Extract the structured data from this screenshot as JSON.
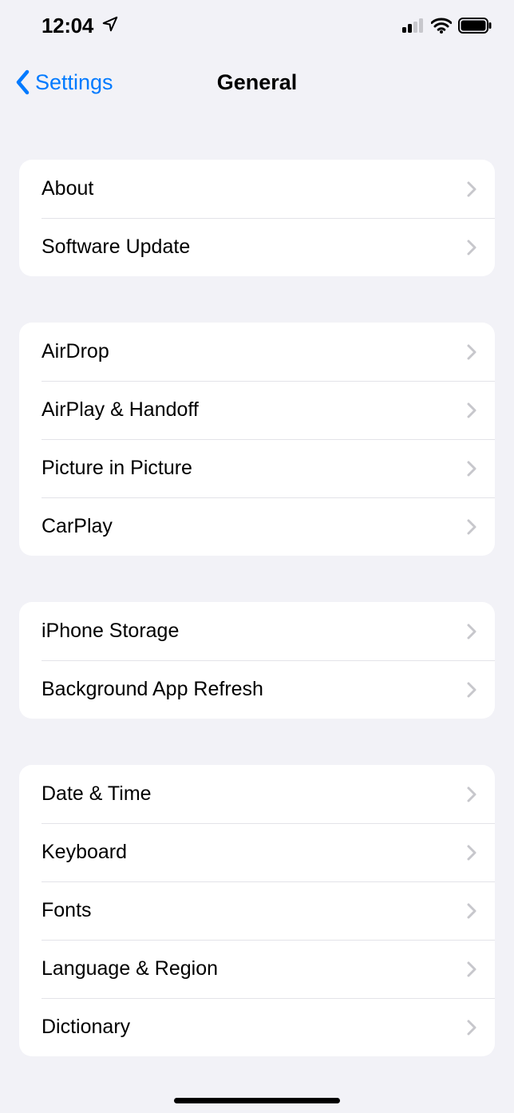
{
  "status": {
    "time": "12:04"
  },
  "nav": {
    "back_label": "Settings",
    "title": "General"
  },
  "groups": [
    {
      "items": [
        {
          "label": "About"
        },
        {
          "label": "Software Update"
        }
      ]
    },
    {
      "items": [
        {
          "label": "AirDrop"
        },
        {
          "label": "AirPlay & Handoff"
        },
        {
          "label": "Picture in Picture"
        },
        {
          "label": "CarPlay"
        }
      ]
    },
    {
      "items": [
        {
          "label": "iPhone Storage"
        },
        {
          "label": "Background App Refresh"
        }
      ]
    },
    {
      "items": [
        {
          "label": "Date & Time"
        },
        {
          "label": "Keyboard"
        },
        {
          "label": "Fonts"
        },
        {
          "label": "Language & Region"
        },
        {
          "label": "Dictionary"
        }
      ]
    }
  ]
}
